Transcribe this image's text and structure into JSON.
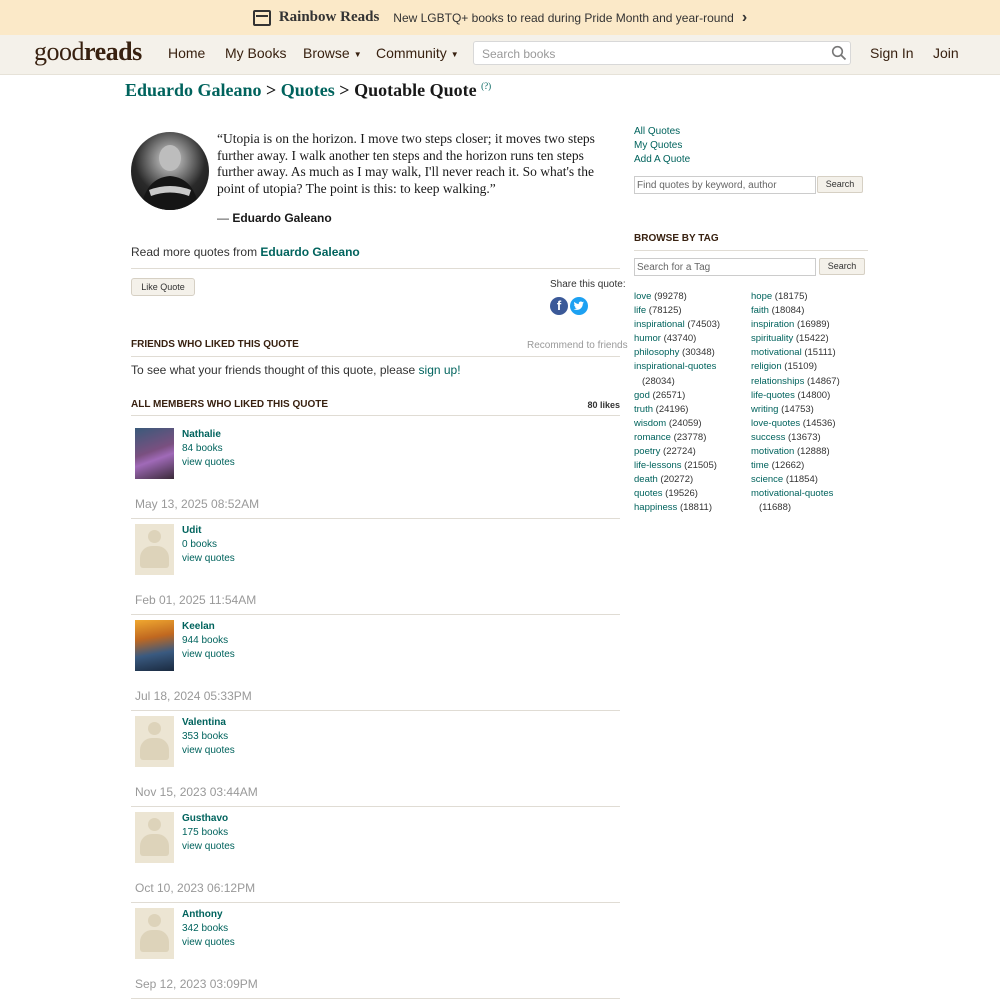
{
  "banner": {
    "brand": "Rainbow Reads",
    "text": "New LGBTQ+ books to read during Pride Month and year-round"
  },
  "nav": {
    "logo_light": "good",
    "logo_bold": "reads",
    "home": "Home",
    "my_books": "My Books",
    "browse": "Browse",
    "community": "Community",
    "search_placeholder": "Search books",
    "sign_in": "Sign In",
    "join": "Join"
  },
  "breadcrumb": {
    "author": "Eduardo Galeano",
    "sep1": ">",
    "quotes": "Quotes",
    "sep2": ">",
    "current": "Quotable Quote",
    "help": "(?)"
  },
  "quote": {
    "text": "“Utopia is on the horizon. I move two steps closer; it moves two steps further away. I walk another ten steps and the horizon runs ten steps further away. As much as I may walk, I'll never reach it. So what's the point of utopia? The point is this: to keep walking.”",
    "dash": "―",
    "author": "Eduardo Galeano",
    "read_more_prefix": "Read more quotes from",
    "read_more_author": "Eduardo Galeano",
    "like_button": "Like Quote",
    "share_label": "Share this quote:"
  },
  "friends": {
    "heading": "Friends Who Liked This Quote",
    "recommend": "Recommend to friends",
    "text_prefix": "To see what your friends thought of this quote, please",
    "signup": "sign up!"
  },
  "members": {
    "heading": "All Members Who Liked This Quote",
    "likes": "80 likes",
    "list": [
      {
        "name": "Nathalie",
        "books": "84 books",
        "view": "view quotes",
        "date": "May 13, 2025 08:52AM",
        "photo": "custom-purple"
      },
      {
        "name": "Udit",
        "books": "0 books",
        "view": "view quotes",
        "date": "Feb 01, 2025 11:54AM",
        "photo": "default"
      },
      {
        "name": "Keelan",
        "books": "944 books",
        "view": "view quotes",
        "date": "Jul 18, 2024 05:33PM",
        "photo": "custom-sunset"
      },
      {
        "name": "Valentina",
        "books": "353 books",
        "view": "view quotes",
        "date": "Nov 15, 2023 03:44AM",
        "photo": "default"
      },
      {
        "name": "Gusthavo",
        "books": "175 books",
        "view": "view quotes",
        "date": "Oct 10, 2023 06:12PM",
        "photo": "default"
      },
      {
        "name": "Anthony",
        "books": "342 books",
        "view": "view quotes",
        "date": "Sep 12, 2023 03:09PM",
        "photo": "default"
      }
    ]
  },
  "sidebar": {
    "all_quotes": "All Quotes",
    "my_quotes": "My Quotes",
    "add_quote": "Add A Quote",
    "search_placeholder": "Find quotes by keyword, author",
    "search_button": "Search",
    "browse_by_tag": "Browse By Tag",
    "tag_placeholder": "Search for a Tag",
    "tag_button": "Search",
    "tags_left": [
      [
        "love",
        "(99278)"
      ],
      [
        "life",
        "(78125)"
      ],
      [
        "inspirational",
        "(74503)"
      ],
      [
        "humor",
        "(43740)"
      ],
      [
        "philosophy",
        "(30348)"
      ],
      [
        "inspirational-quotes",
        "(28034)"
      ],
      [
        "god",
        "(26571)"
      ],
      [
        "truth",
        "(24196)"
      ],
      [
        "wisdom",
        "(24059)"
      ],
      [
        "romance",
        "(23778)"
      ],
      [
        "poetry",
        "(22724)"
      ],
      [
        "life-lessons",
        "(21505)"
      ],
      [
        "death",
        "(20272)"
      ],
      [
        "quotes",
        "(19526)"
      ],
      [
        "happiness",
        "(18811)"
      ]
    ],
    "tags_right": [
      [
        "hope",
        "(18175)"
      ],
      [
        "faith",
        "(18084)"
      ],
      [
        "inspiration",
        "(16989)"
      ],
      [
        "spirituality",
        "(15422)"
      ],
      [
        "motivational",
        "(15111)"
      ],
      [
        "religion",
        "(15109)"
      ],
      [
        "relationships",
        "(14867)"
      ],
      [
        "life-quotes",
        "(14800)"
      ],
      [
        "writing",
        "(14753)"
      ],
      [
        "love-quotes",
        "(14536)"
      ],
      [
        "success",
        "(13673)"
      ],
      [
        "motivation",
        "(12888)"
      ],
      [
        "time",
        "(12662)"
      ],
      [
        "science",
        "(11854)"
      ],
      [
        "motivational-quotes",
        "(11688)"
      ]
    ]
  },
  "colors": {
    "link": "#00635d",
    "nav_bg": "#f4f1ea",
    "banner_bg": "#fbe9c8",
    "heading": "#382110"
  }
}
